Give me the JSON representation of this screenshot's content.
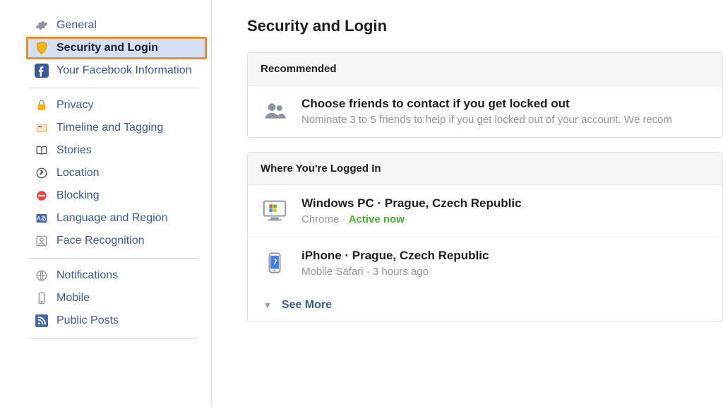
{
  "sidebar": {
    "items": [
      {
        "label": "General"
      },
      {
        "label": "Security and Login"
      },
      {
        "label": "Your Facebook Information"
      },
      {
        "label": "Privacy"
      },
      {
        "label": "Timeline and Tagging"
      },
      {
        "label": "Stories"
      },
      {
        "label": "Location"
      },
      {
        "label": "Blocking"
      },
      {
        "label": "Language and Region"
      },
      {
        "label": "Face Recognition"
      },
      {
        "label": "Notifications"
      },
      {
        "label": "Mobile"
      },
      {
        "label": "Public Posts"
      }
    ]
  },
  "page": {
    "title": "Security and Login"
  },
  "recommended": {
    "header": "Recommended",
    "title": "Choose friends to contact if you get locked out",
    "subtitle": "Nominate 3 to 5 friends to help if you get locked out of your account. We recom"
  },
  "sessions": {
    "header": "Where You're Logged In",
    "items": [
      {
        "title": "Windows PC · Prague, Czech Republic",
        "browser": "Chrome",
        "sep": " · ",
        "status": "Active now"
      },
      {
        "title": "iPhone · Prague, Czech Republic",
        "details": "Mobile Safari · 3 hours ago"
      }
    ],
    "see_more": "See More"
  }
}
